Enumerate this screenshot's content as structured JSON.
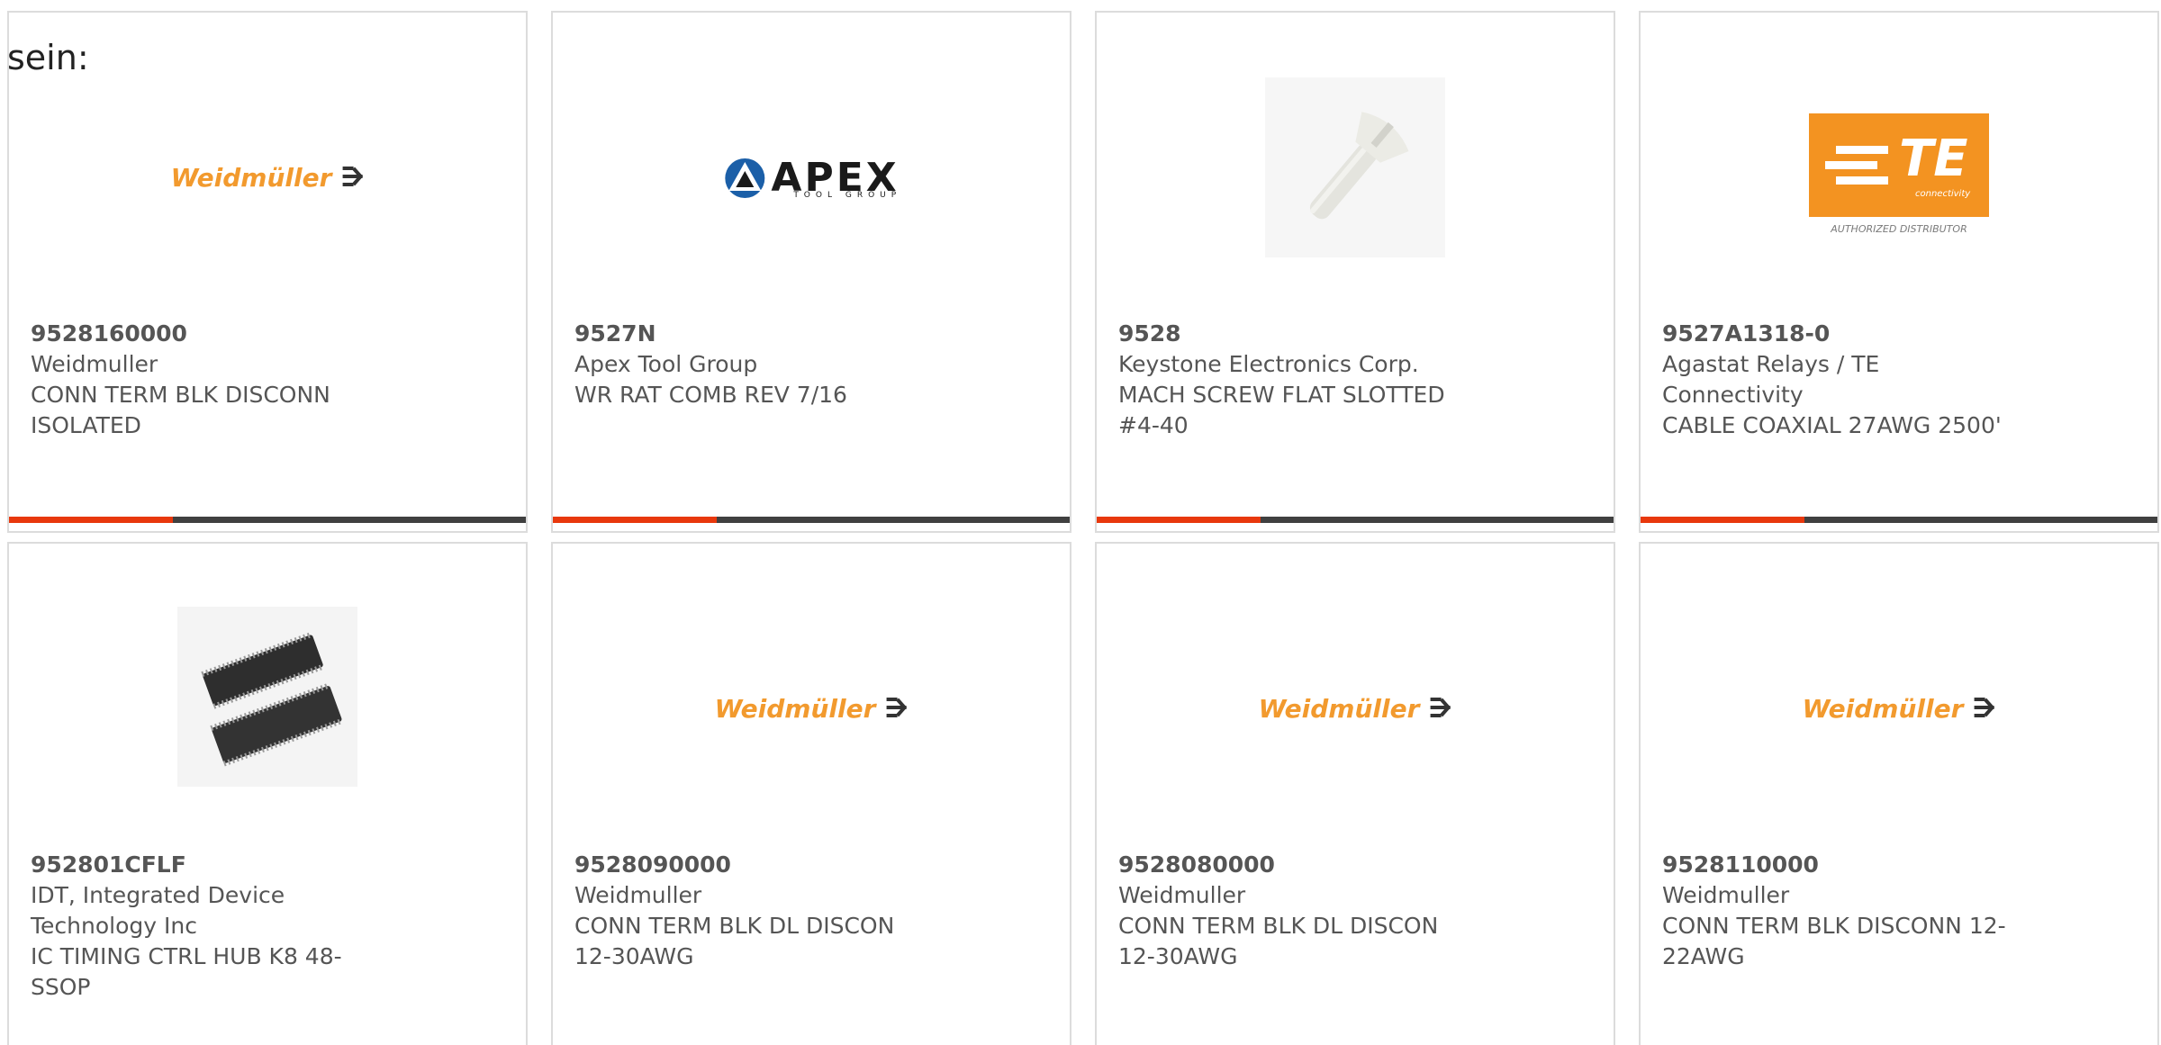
{
  "intro_text": "sein:",
  "colors": {
    "card_border": "#dcdcdc",
    "bar_accent": "#e8380d",
    "bar_base": "#404040",
    "text": "#555555",
    "weidmuller_orange": "#f29a2e",
    "te_orange": "#f39321"
  },
  "cards": [
    {
      "part_number": "9528160000",
      "manufacturer": "Weidmuller",
      "description": "CONN TERM BLK DISCONN ISOLATED",
      "image": "weidmuller-logo",
      "logo_text": "Weidmüller"
    },
    {
      "part_number": "9527N",
      "manufacturer": "Apex Tool Group",
      "description": "WR RAT COMB REV 7/16",
      "image": "apex-tool-group-logo",
      "logo_text": "APEX",
      "logo_subtext": "TOOL GROUP"
    },
    {
      "part_number": "9528",
      "manufacturer": "Keystone Electronics Corp.",
      "description": "MACH SCREW FLAT SLOTTED #4-40",
      "image": "screw-photo"
    },
    {
      "part_number": "9527A1318-0",
      "manufacturer": "Agastat Relays / TE Connectivity",
      "description": "CABLE COAXIAL 27AWG 2500'",
      "image": "te-connectivity-logo",
      "logo_text": "TE",
      "logo_subtext": "connectivity",
      "logo_caption": "AUTHORIZED DISTRIBUTOR"
    },
    {
      "part_number": "952801CFLF",
      "manufacturer": "IDT, Integrated Device Technology Inc",
      "description": "IC TIMING CTRL HUB K8 48-SSOP",
      "image": "ic-chip-photo"
    },
    {
      "part_number": "9528090000",
      "manufacturer": "Weidmuller",
      "description": "CONN TERM BLK DL DISCON 12-30AWG",
      "image": "weidmuller-logo",
      "logo_text": "Weidmüller"
    },
    {
      "part_number": "9528080000",
      "manufacturer": "Weidmuller",
      "description": "CONN TERM BLK DL DISCON 12-30AWG",
      "image": "weidmuller-logo",
      "logo_text": "Weidmüller"
    },
    {
      "part_number": "9528110000",
      "manufacturer": "Weidmuller",
      "description": "CONN TERM BLK DISCONN 12-22AWG",
      "image": "weidmuller-logo",
      "logo_text": "Weidmüller"
    }
  ]
}
